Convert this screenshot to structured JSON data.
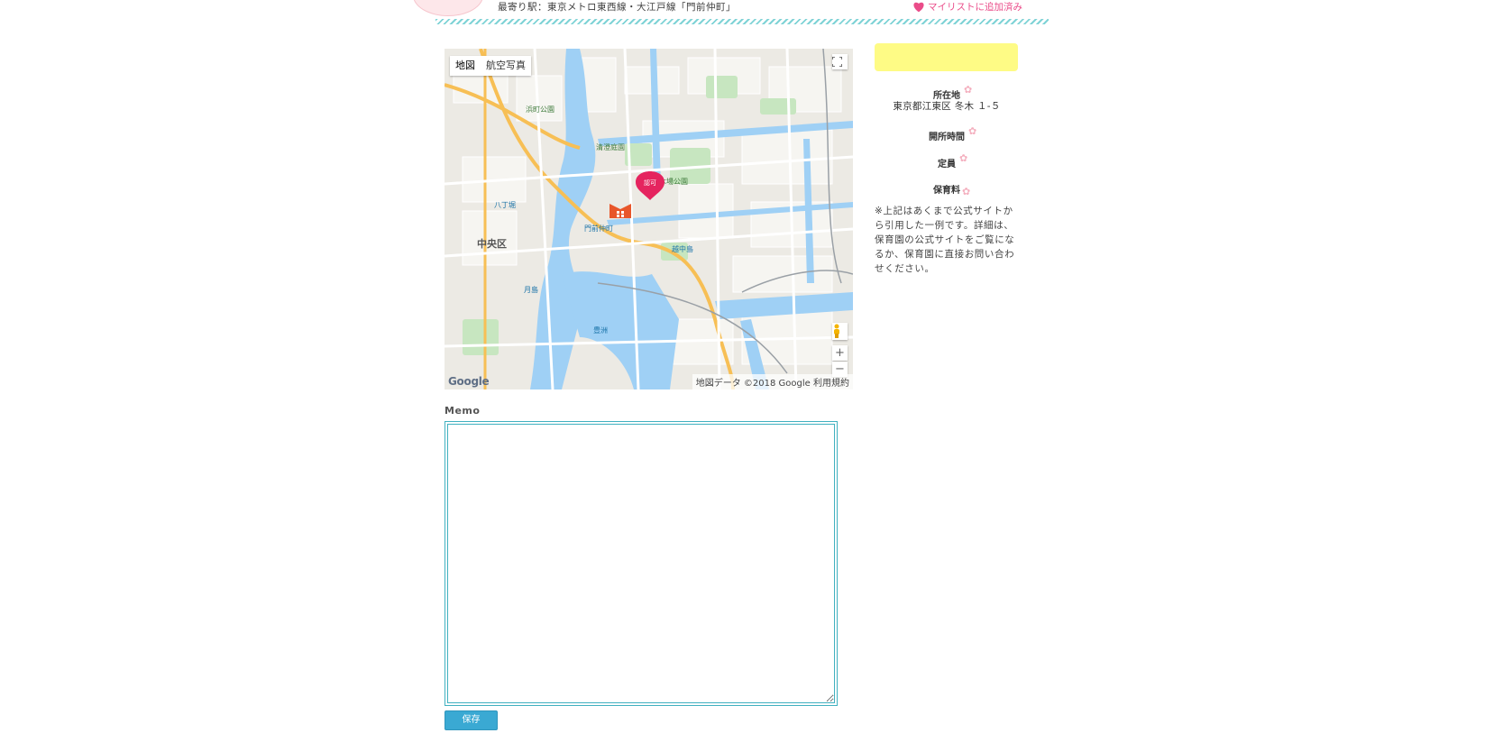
{
  "header": {
    "station": "最寄り駅：東京メトロ東西線・大江戸線「門前仲町」",
    "mylist_label": "マイリストに追加済み",
    "colors": {
      "accent_pink": "#ea4c89",
      "stripe": "#7fd3d6"
    }
  },
  "map": {
    "type_buttons": [
      "地図",
      "航空写真"
    ],
    "zoom_in": "+",
    "zoom_out": "−",
    "attribution": "地図データ ©2018 Google 利用規約",
    "logo": "Google",
    "labels": {
      "chuo": "中央区",
      "monzen": "門前仲町",
      "ninka": "認可",
      "kiba": "木場公園",
      "tsukishima": "月島",
      "hamacho": "浜町公園",
      "kiyosumi": "清澄庭園",
      "toyosu": "豊洲",
      "etchujima": "越中島",
      "hatchobori": "八丁堀"
    }
  },
  "memo": {
    "label": "Memo",
    "value": "",
    "save_label": "保存"
  },
  "sidebar": {
    "location_title": "所在地",
    "address": "東京都江東区 冬木 １-５",
    "hours_title": "開所時間",
    "capacity_title": "定員",
    "fee_title": "保育料",
    "note": "※上記はあくまで公式サイトから引用した一例です。詳細は、保育園の公式サイトをご覧になるか、保育園に直接お問い合わせください。"
  }
}
